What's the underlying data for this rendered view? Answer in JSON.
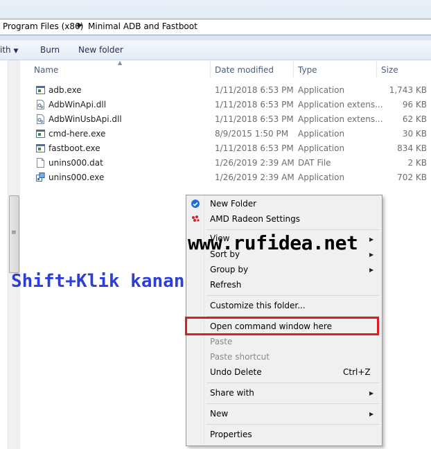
{
  "address": {
    "crumbs": [
      "Program Files (x86)",
      "Minimal ADB and Fastboot"
    ],
    "separator": "▶"
  },
  "toolbar": {
    "partial_label": "ith",
    "burn_label": "Burn",
    "new_folder_label": "New folder"
  },
  "columns": {
    "name": "Name",
    "date_modified": "Date modified",
    "type": "Type",
    "size": "Size"
  },
  "files": [
    {
      "name": "adb.exe",
      "date": "1/11/2018 6:53 PM",
      "type": "Application",
      "size": "1,743 KB",
      "icon": "application-icon"
    },
    {
      "name": "AdbWinApi.dll",
      "date": "1/11/2018 6:53 PM",
      "type": "Application extens...",
      "size": "96 KB",
      "icon": "dll-icon"
    },
    {
      "name": "AdbWinUsbApi.dll",
      "date": "1/11/2018 6:53 PM",
      "type": "Application extens...",
      "size": "62 KB",
      "icon": "dll-icon"
    },
    {
      "name": "cmd-here.exe",
      "date": "8/9/2015 1:50 PM",
      "type": "Application",
      "size": "30 KB",
      "icon": "application-icon"
    },
    {
      "name": "fastboot.exe",
      "date": "1/11/2018 6:53 PM",
      "type": "Application",
      "size": "834 KB",
      "icon": "application-icon"
    },
    {
      "name": "unins000.dat",
      "date": "1/26/2019 2:39 AM",
      "type": "DAT File",
      "size": "2 KB",
      "icon": "file-icon"
    },
    {
      "name": "unins000.exe",
      "date": "1/26/2019 2:39 AM",
      "type": "Application",
      "size": "702 KB",
      "icon": "uninstaller-icon"
    }
  ],
  "context_menu": {
    "new_folder": "New Folder",
    "amd_settings": "AMD Radeon Settings",
    "view": "View",
    "sort_by": "Sort by",
    "group_by": "Group by",
    "refresh": "Refresh",
    "customize": "Customize this folder...",
    "open_cmd": "Open command window here",
    "paste": "Paste",
    "paste_shortcut": "Paste shortcut",
    "undo_delete": "Undo Delete",
    "undo_shortcut": "Ctrl+Z",
    "share_with": "Share with",
    "new": "New",
    "properties": "Properties"
  },
  "overlay": {
    "watermark": "www.rufidea.net",
    "caption": "Shift+Klik kanan"
  },
  "colors": {
    "highlight": "#e01b24",
    "caption": "#2f3fd4",
    "header_text": "#4c607a"
  }
}
